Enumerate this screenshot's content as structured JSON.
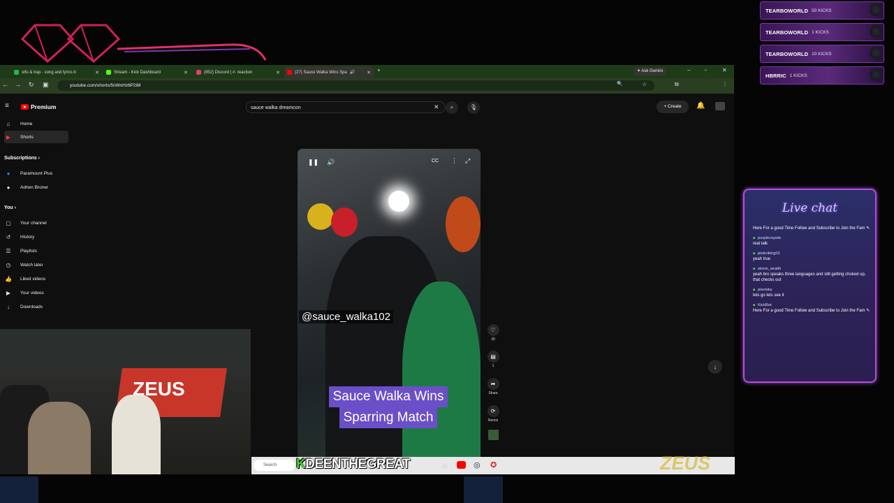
{
  "kick_events": [
    {
      "user": "TEARBOWORLD",
      "detail": "50 KICKS"
    },
    {
      "user": "TEARBOWORLD",
      "detail": "1 KICKS"
    },
    {
      "user": "TEARBOWORLD",
      "detail": "10 KICKS"
    },
    {
      "user": "HBRRIC",
      "detail": "1 KICKS"
    }
  ],
  "browser": {
    "tabs": [
      {
        "label": "stfu & trap - song and lyrics b"
      },
      {
        "label": "Stream - Kick Dashboard"
      },
      {
        "label": "(852) Discord | #· reaction"
      },
      {
        "label": "(27) Sauce Walka Wins Spa"
      }
    ],
    "ask_gemini": "Ask Gemini",
    "url": "youtube.com/shorts/5nWxHz6P2iM"
  },
  "youtube": {
    "brand": "Premium",
    "search_value": "sauce walka dreamcon",
    "create_label": "Create",
    "sidebar_top": [
      {
        "label": "Home",
        "icon": "home-icon"
      },
      {
        "label": "Shorts",
        "icon": "shorts-icon"
      }
    ],
    "subscriptions_label": "Subscriptions",
    "subscriptions": [
      {
        "label": "Paramount Plus"
      },
      {
        "label": "Adrien Broner"
      }
    ],
    "you_label": "You",
    "you_items": [
      {
        "label": "Your channel"
      },
      {
        "label": "History"
      },
      {
        "label": "Playlists"
      },
      {
        "label": "Watch later"
      },
      {
        "label": "Liked videos"
      },
      {
        "label": "Your videos"
      },
      {
        "label": "Downloads"
      }
    ],
    "video": {
      "handle": "@sauce_walka102",
      "caption_line1": "Sauce Walka Wins",
      "caption_line2": "Sparring Match"
    },
    "actions": {
      "likes": "30",
      "comments": "1",
      "share": "Share",
      "remix": "Remix"
    }
  },
  "taskbar": {
    "search_placeholder": "Search",
    "streamer_name": "DEENTHEGREAT",
    "streamer_prefix": "K",
    "sponsor": "ZEUS"
  },
  "chat": {
    "title": "Live chat",
    "messages": [
      {
        "user": "",
        "text": "Here For a good Time Follow and Subscribe to Join the Fam"
      },
      {
        "user": "purplecoyote",
        "text": "real talk"
      },
      {
        "user": "pinkviking01",
        "text": "yeah true"
      },
      {
        "user": "storm_wraith",
        "text": "yeah bro speaks three languages and still getting choked up, that checks out"
      },
      {
        "user": "pixelsky",
        "text": "lets go lets see it"
      },
      {
        "user": "KickBot",
        "text": "Here For a good Time Follow and Subscribe to Join the Fam"
      }
    ]
  },
  "colors": {
    "kick_green": "#53fc18",
    "youtube_red": "#ff0000",
    "caption_purple": "#6b4fc8",
    "chat_border": "#b24fd8"
  }
}
